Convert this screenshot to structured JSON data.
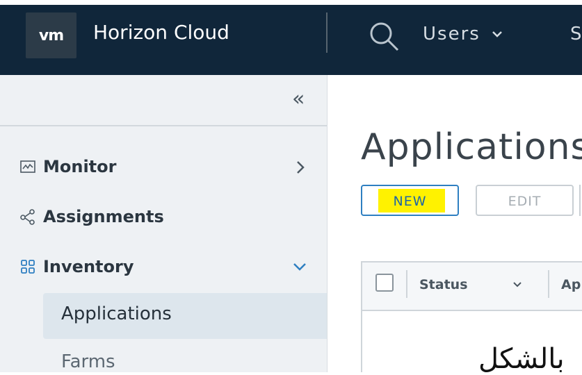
{
  "header": {
    "logo": "vm",
    "app_title": "Horizon Cloud",
    "nav_users": "Users",
    "nav_more": "S",
    "icons": [
      "search-icon",
      "chevron-down-icon"
    ]
  },
  "sidebar": {
    "collapse_label": "«",
    "items": [
      {
        "label": "Monitor",
        "icon": "monitor-icon",
        "expanded": false
      },
      {
        "label": "Assignments",
        "icon": "share-icon"
      },
      {
        "label": "Inventory",
        "icon": "grid-icon",
        "expanded": true
      }
    ],
    "subitems": [
      {
        "label": "Applications",
        "active": true
      },
      {
        "label": "Farms",
        "active": false
      }
    ]
  },
  "main": {
    "title": "Applications",
    "buttons": {
      "new": "NEW",
      "edit": "EDIT"
    },
    "table": {
      "columns": [
        "Status",
        "Ap"
      ]
    },
    "overlay_text": "بالشكل"
  },
  "colors": {
    "header_bg": "#10263a",
    "sidebar_bg": "#eef1f4",
    "active_item_bg": "#dde6ed",
    "primary_blue": "#2e7fc1",
    "highlight": "#fff200"
  }
}
